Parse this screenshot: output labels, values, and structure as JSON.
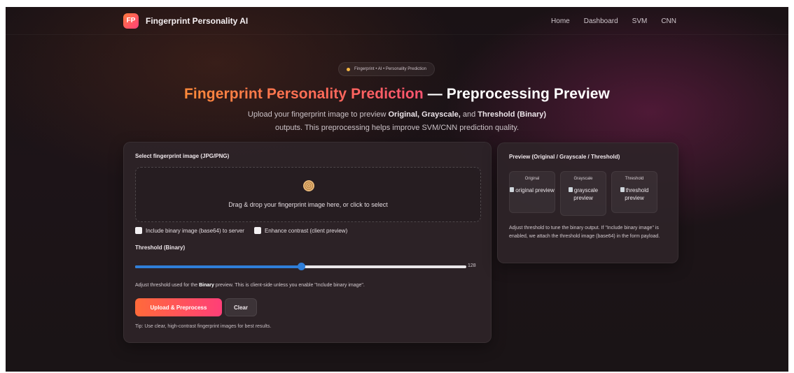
{
  "nav": {
    "logo": "FP",
    "brand": "Fingerprint Personality AI",
    "links": [
      "Home",
      "Dashboard",
      "SVM",
      "CNN"
    ]
  },
  "hero": {
    "pill": "Fingerprint • AI • Personality Prediction",
    "title_accent": "Fingerprint Personality Prediction",
    "title_rest": "— Preprocessing Preview",
    "sub_line1_a": "Upload your fingerprint image to preview ",
    "sub_line1_b": "Original, Grayscale,",
    "sub_line1_c": " and ",
    "sub_line1_d": "Threshold (Binary)",
    "sub_line2": "outputs. This preprocessing helps improve SVM/CNN prediction quality."
  },
  "upload": {
    "title": "Select fingerprint image (JPG/PNG)",
    "dropzone_icon": "fingerprint-icon",
    "dropzone_text": "Drag & drop your fingerprint image here, or click to select",
    "check_binary": "Include binary image (base64) to server",
    "check_contrast": "Enhance contrast (client preview)",
    "threshold_label": "Threshold (Binary)",
    "threshold_value": "128",
    "threshold_fraction": 0.502,
    "hint_a": "Adjust threshold used for the ",
    "hint_b": "Binary",
    "hint_c": " preview. This is client-side unless you enable \"Include binary image\".",
    "btn_upload": "Upload & Preprocess",
    "btn_clear": "Clear",
    "tip": "Tip: Use clear, high-contrast fingerprint images for best results."
  },
  "preview": {
    "title": "Preview (Original / Grayscale / Threshold)",
    "tiles": [
      {
        "head": "Original",
        "alt": "original preview"
      },
      {
        "head": "Grayscale",
        "alt": "grayscale preview"
      },
      {
        "head": "Threshold",
        "alt": "threshold preview"
      }
    ],
    "note": "Adjust threshold to tune the binary output. If \"Include binary image\" is enabled, we attach the threshold image (base64) in the form payload."
  },
  "colors": {
    "accent_start": "#ff6a3a",
    "accent_end": "#ff3f78",
    "slider": "#2f7ed8",
    "background": "#1a1215"
  }
}
